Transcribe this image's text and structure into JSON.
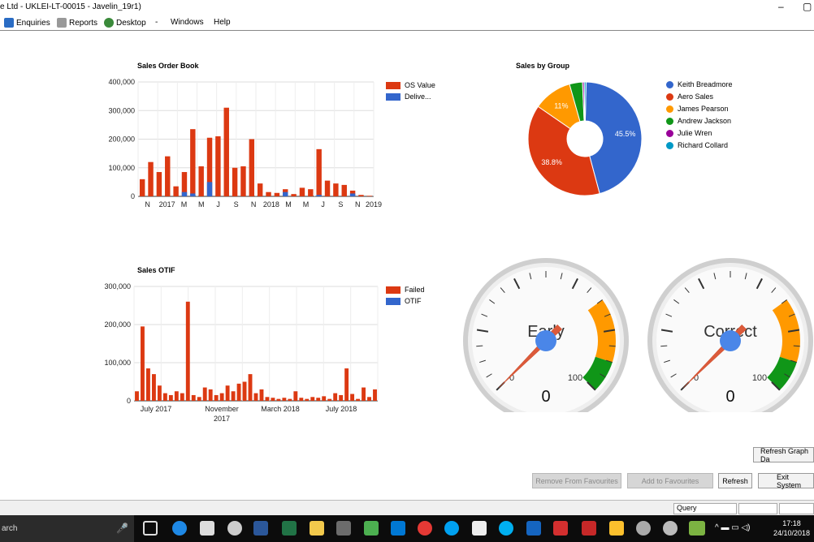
{
  "window": {
    "title": "e Ltd - UKLEI-LT-00015 - Javelin_19r1)",
    "minimize": "–",
    "restore": "▢"
  },
  "menu": [
    {
      "label": "Enquiries",
      "icon": "enquiries-icon",
      "color": "#2a6cc4"
    },
    {
      "label": "Reports",
      "icon": "reports-icon",
      "color": "#888888"
    },
    {
      "label": "Desktop",
      "icon": "desktop-icon",
      "color": "#3a8a3a"
    },
    {
      "label": "-",
      "icon": "",
      "color": ""
    },
    {
      "label": "Windows",
      "icon": "",
      "color": ""
    },
    {
      "label": "Help",
      "icon": "",
      "color": ""
    }
  ],
  "colors": {
    "red": "#dc3912",
    "blue": "#3366cc",
    "orange": "#ff9900",
    "green": "#109618",
    "purple": "#990099",
    "teal": "#0099c6"
  },
  "sales_order_book": {
    "title": "Sales Order Book",
    "legend": [
      "OS Value",
      "Delive..."
    ],
    "y_ticks": [
      "400,000",
      "300,000",
      "200,000",
      "100,000",
      "0"
    ],
    "x_ticks": [
      "N",
      "2017",
      "M",
      "M",
      "J",
      "S",
      "N",
      "2018",
      "M",
      "M",
      "J",
      "S",
      "N",
      "2019"
    ]
  },
  "sales_otif": {
    "title": "Sales OTIF",
    "legend": [
      "Failed",
      "OTIF"
    ],
    "y_ticks": [
      "300,000",
      "200,000",
      "100,000",
      "0"
    ],
    "x_ticks": [
      "July 2017",
      "November",
      "March 2018",
      "July 2018"
    ],
    "x_tick_sub": "2017"
  },
  "sales_by_group": {
    "title": "Sales by Group",
    "slice_labels": [
      "45.5%",
      "38.8%",
      "11%"
    ]
  },
  "gauges": [
    {
      "label": "Early",
      "value": "0",
      "min": "0",
      "max": "100",
      "reading": 0
    },
    {
      "label": "Correct",
      "value": "0",
      "min": "0",
      "max": "100",
      "reading": 0
    }
  ],
  "buttons": {
    "refresh_graph": "Refresh Graph Da",
    "remove_fav": "Remove From Favourites",
    "add_fav": "Add to Favourites",
    "refresh": "Refresh",
    "exit": "Exit System"
  },
  "status": {
    "query": "Query"
  },
  "taskbar": {
    "search": "arch",
    "time": "17:18",
    "date": "24/10/2018"
  },
  "chart_data": [
    {
      "type": "bar",
      "title": "Sales Order Book",
      "ylim": [
        0,
        400000
      ],
      "legend_position": "right",
      "grid": true,
      "series": [
        {
          "name": "OS Value",
          "values": [
            60000,
            120000,
            85000,
            140000,
            35000,
            85000,
            235000,
            105000,
            205000,
            210000,
            310000,
            100000,
            105000,
            200000,
            45000,
            15000,
            12000,
            25000,
            8000,
            30000,
            25000,
            165000,
            55000,
            45000,
            40000,
            20000,
            5000,
            2000
          ]
        },
        {
          "name": "Delive...",
          "values": [
            0,
            0,
            0,
            0,
            0,
            15000,
            10000,
            0,
            50000,
            0,
            0,
            0,
            0,
            0,
            0,
            0,
            0,
            15000,
            0,
            0,
            0,
            5000,
            0,
            0,
            0,
            10000,
            0,
            0
          ]
        }
      ]
    },
    {
      "type": "bar",
      "title": "Sales OTIF",
      "ylim": [
        0,
        300000
      ],
      "legend_position": "right",
      "grid": true,
      "series": [
        {
          "name": "Failed",
          "values": [
            25000,
            195000,
            85000,
            70000,
            40000,
            20000,
            15000,
            25000,
            20000,
            260000,
            15000,
            10000,
            35000,
            30000,
            15000,
            20000,
            40000,
            25000,
            45000,
            50000,
            70000,
            20000,
            30000,
            10000,
            8000,
            5000,
            8000,
            5000,
            25000,
            8000,
            5000,
            10000,
            8000,
            12000,
            5000,
            20000,
            15000,
            85000,
            18000,
            5000,
            35000,
            10000,
            30000
          ]
        },
        {
          "name": "OTIF",
          "values": [
            0,
            0,
            0,
            0,
            0,
            0,
            0,
            0,
            0,
            0,
            0,
            0,
            0,
            0,
            0,
            0,
            0,
            0,
            0,
            0,
            0,
            0,
            0,
            0,
            0,
            0,
            0,
            0,
            0,
            0,
            0,
            0,
            0,
            0,
            0,
            0,
            0,
            0,
            0,
            0,
            0,
            0,
            0
          ]
        }
      ]
    },
    {
      "type": "pie",
      "title": "Sales by Group",
      "legend_position": "right",
      "categories": [
        "Keith Breadmore",
        "Aero Sales",
        "James Pearson",
        "Andrew Jackson",
        "Julie Wren",
        "Richard Collard"
      ],
      "values": [
        45.5,
        38.8,
        11,
        3.7,
        0.5,
        0.5
      ]
    }
  ]
}
